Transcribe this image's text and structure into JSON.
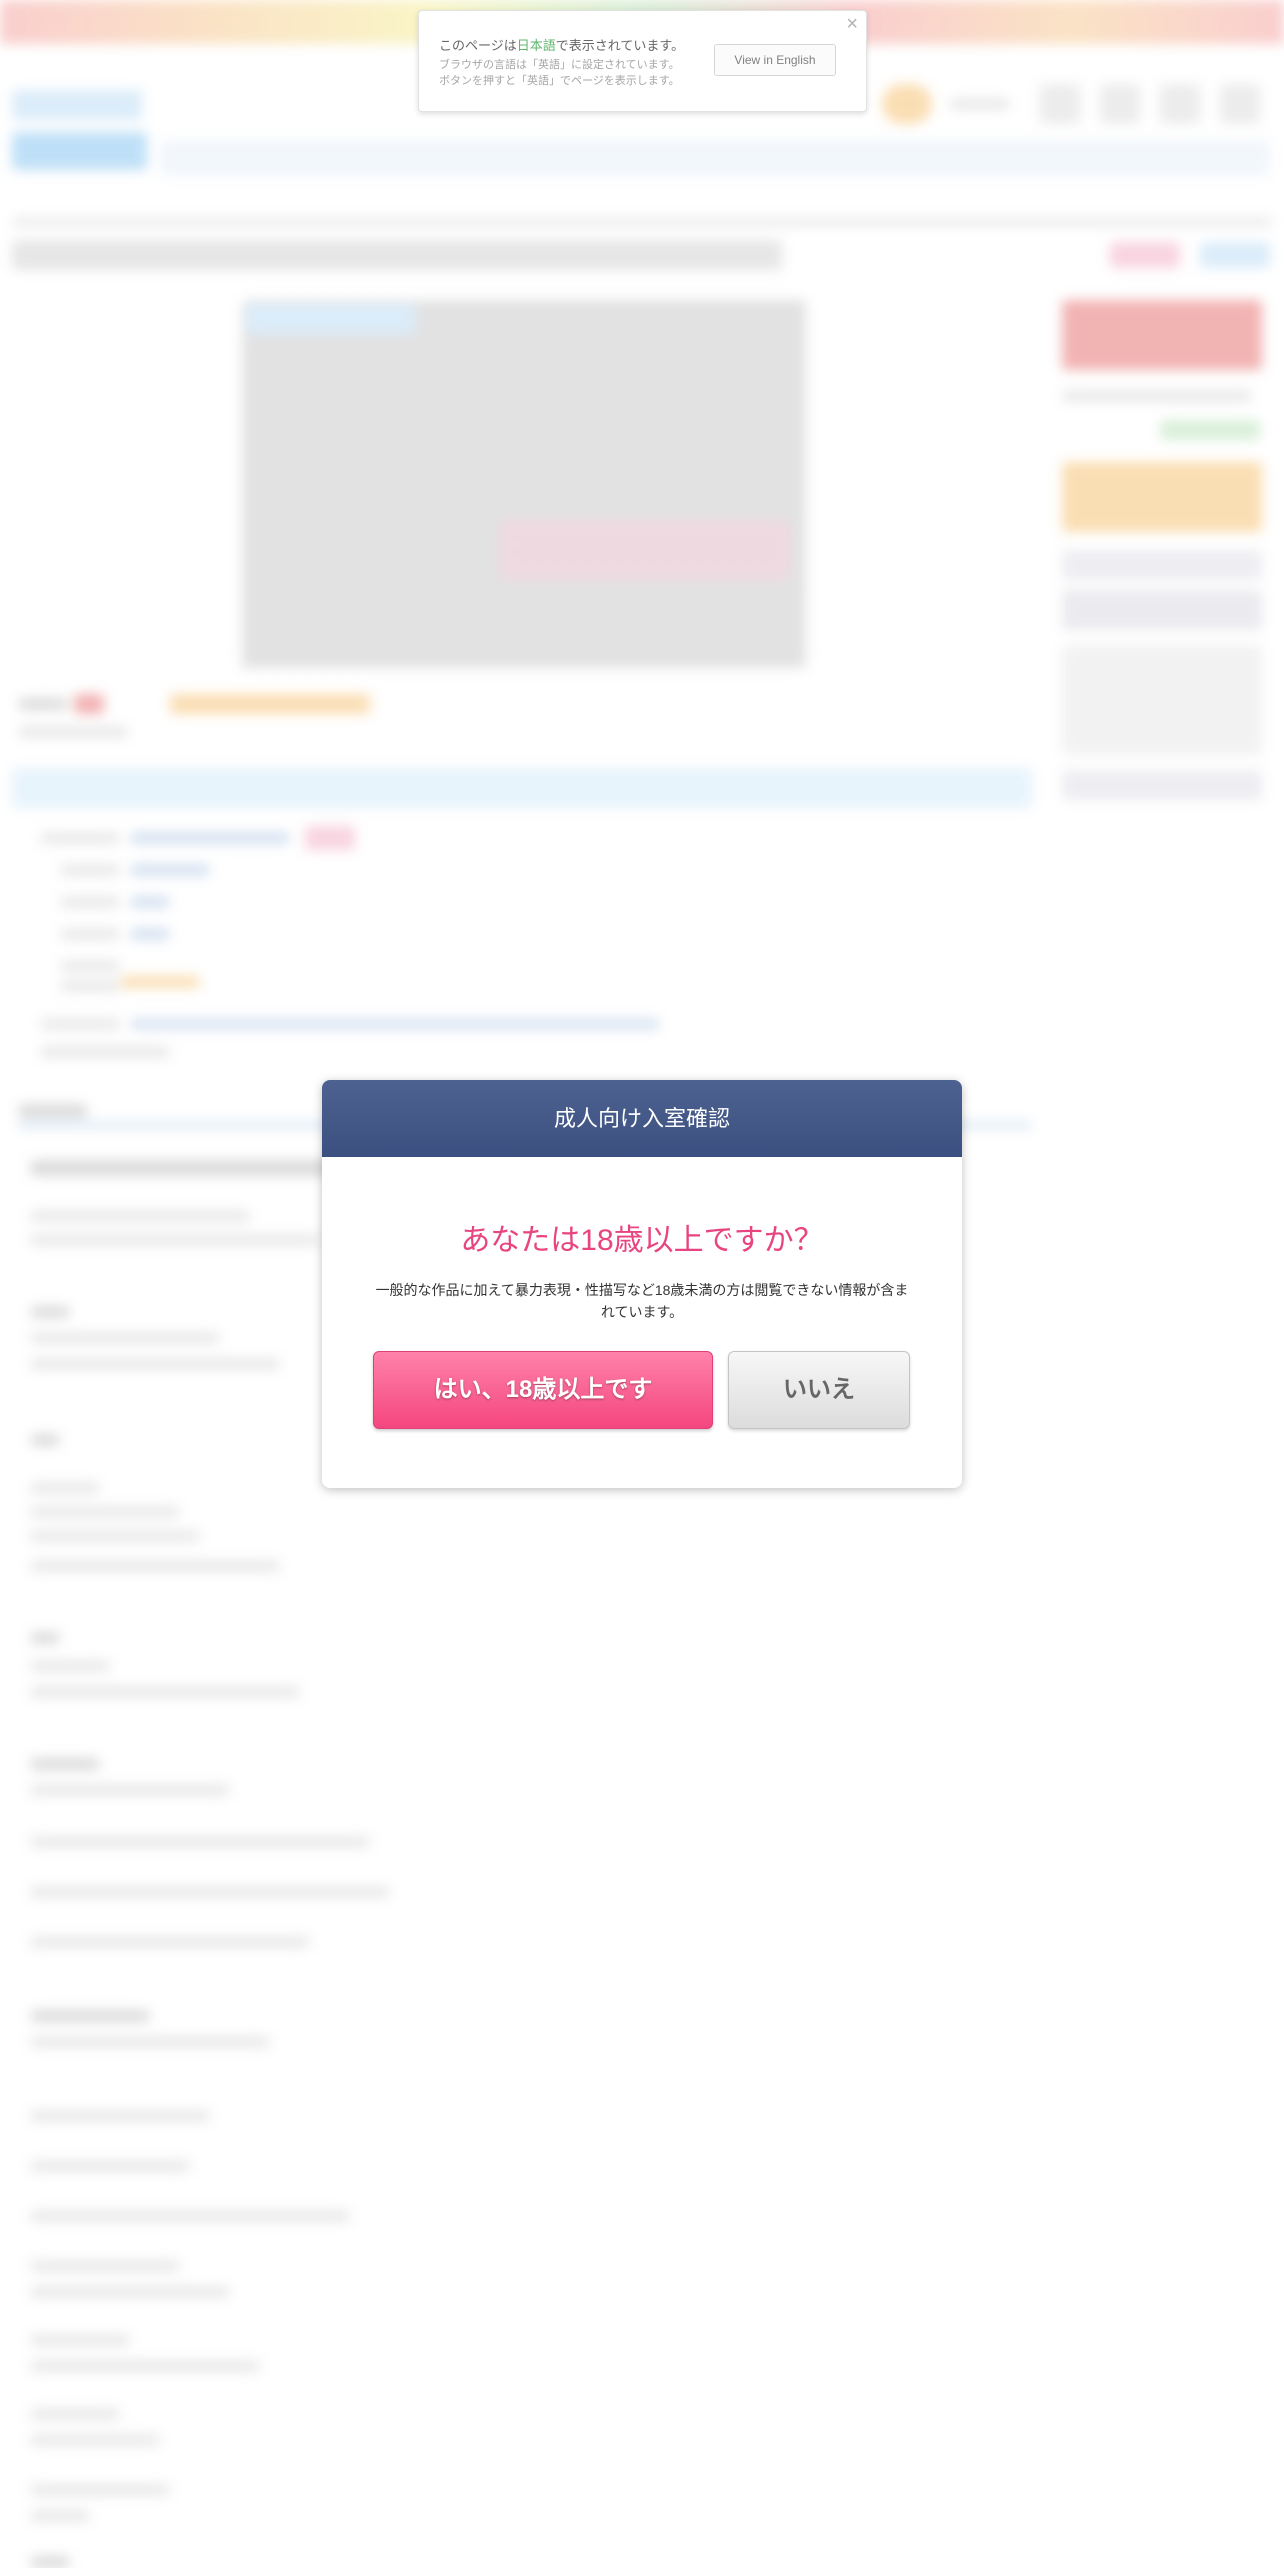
{
  "language_notice": {
    "line1_prefix": "このページは",
    "line1_language": "日本語",
    "line1_suffix": "で表示されています。",
    "line2": "ブラウザの言語は「英語」に設定されています。",
    "line3": "ボタンを押すと「英語」でページを表示します。",
    "button_label": "View in English",
    "close_glyph": "×"
  },
  "age_modal": {
    "title": "成人向け入室確認",
    "question": "あなたは18歳以上ですか？",
    "description": "一般的な作品に加えて暴力表現・性描写など18歳未満の方は閲覧できない情報が含まれています。",
    "yes_label": "はい、18歳以上です",
    "no_label": "いいえ"
  },
  "colors": {
    "modal_header": "#44598a",
    "question_pink": "#e8447f",
    "yes_button": "#f4467f",
    "language_highlight": "#2a9d3c"
  }
}
